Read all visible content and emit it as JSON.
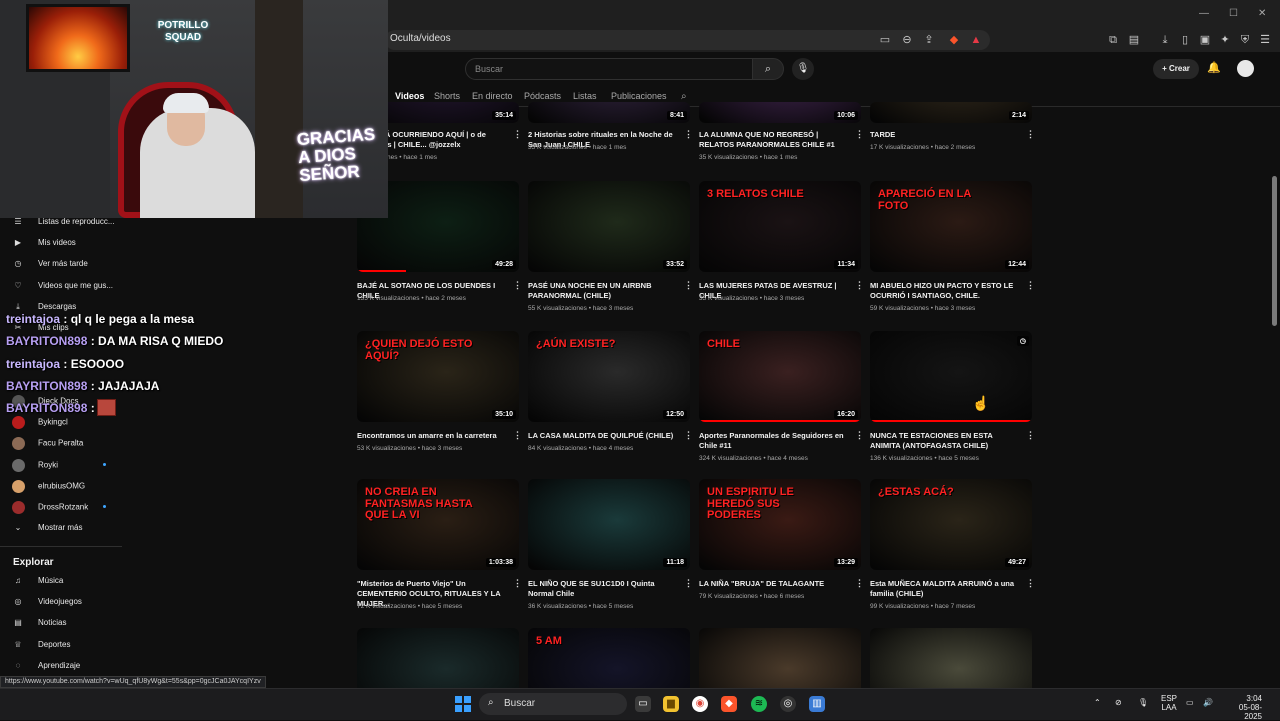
{
  "browser": {
    "url": "Oculta/videos",
    "window_controls": [
      "—",
      "☐",
      "✕"
    ]
  },
  "yt_header": {
    "search_placeholder": "Buscar",
    "create_label": "Crear"
  },
  "tabs": [
    "Videos",
    "Shorts",
    "En directo",
    "Pódcasts",
    "Listas",
    "Publicaciones"
  ],
  "active_tab": "Videos",
  "sidebar": {
    "items": [
      {
        "label": "Listas de reproducc...",
        "icon": "playlist-icon",
        "glyph": "☰"
      },
      {
        "label": "Mis videos",
        "icon": "my-videos-icon",
        "glyph": "▶"
      },
      {
        "label": "Ver más tarde",
        "icon": "watch-later-icon",
        "glyph": "◷"
      },
      {
        "label": "Videos que me gus...",
        "icon": "like-icon",
        "glyph": "👍"
      },
      {
        "label": "Descargas",
        "icon": "download-icon",
        "glyph": "⤓"
      },
      {
        "label": "Mis clips",
        "icon": "clip-icon",
        "glyph": "✂"
      }
    ],
    "subscriptions": [
      {
        "label": "Dieck Docs",
        "color": "#555555",
        "dot": false
      },
      {
        "label": "Bykingcl",
        "color": "#b91c1c",
        "dot": false
      },
      {
        "label": "Facu Peralta",
        "color": "#8b6a55",
        "dot": false
      },
      {
        "label": "Royki",
        "color": "#6a6a6a",
        "dot": true
      },
      {
        "label": "elrubiusOMG",
        "color": "#d7a06a",
        "dot": false
      },
      {
        "label": "DrossRotzank",
        "color": "#9b2c2c",
        "dot": true
      }
    ],
    "show_more": "Mostrar más",
    "explore_title": "Explorar",
    "explore": [
      {
        "label": "Música",
        "icon": "music-icon",
        "glyph": "♫"
      },
      {
        "label": "Videojuegos",
        "icon": "gaming-icon",
        "glyph": "🎮"
      },
      {
        "label": "Noticias",
        "icon": "news-icon",
        "glyph": "📰"
      },
      {
        "label": "Deportes",
        "icon": "trophy-icon",
        "glyph": "🏆"
      },
      {
        "label": "Aprendizaje",
        "icon": "lightbulb-icon",
        "glyph": "💡"
      }
    ]
  },
  "webcam": {
    "logo_text": "POTRILLO SQUAD",
    "neon_text": "GRACIAS A DIOS SEÑOR"
  },
  "chat": [
    {
      "user": "treintajoa",
      "message": "ql q le pega a la mesa"
    },
    {
      "user": "BAYRITON898",
      "message": "DA MA RISA Q MIEDO"
    },
    {
      "user": "treintajoa",
      "message": "ESOOOO"
    },
    {
      "user": "BAYRITON898",
      "message": "JAJAJAJA"
    },
    {
      "user": "BAYRITON898",
      "message": ""
    }
  ],
  "videos": [
    {
      "title": "RO ESTÁ OCURRIENDO AQUÍ | o de mascotas | CHILE... @jozzelx",
      "meta": "isualizaciones • hace 1 mes",
      "duration": "35:14",
      "bg": "#2a1a3a"
    },
    {
      "title": "2 Historias sobre rituales en la Noche de San Juan I CHILE",
      "meta": "35 K visualizaciones • hace 1 mes",
      "duration": "8:41",
      "bg": "#3a2a4a"
    },
    {
      "title": "LA ALUMNA QUE NO REGRESÓ | RELATOS PARANORMALES CHILE #1",
      "meta": "35 K visualizaciones • hace 1 mes",
      "duration": "10:06",
      "bg": "#4a2a5a"
    },
    {
      "title": "TARDE",
      "meta": "17 K visualizaciones • hace 2 meses",
      "duration": "2:14",
      "bg": "#3a3020"
    },
    {
      "title": "BAJÉ AL SOTANO DE LOS DUENDES I CHILE",
      "meta": "135 K visualizaciones • hace 2 meses",
      "duration": "49:28",
      "bg": "#0d1f14",
      "overlay": ""
    },
    {
      "title": "PASÉ UNA NOCHE EN UN AIRBNB PARANORMAL (CHILE)",
      "meta": "55 K visualizaciones • hace 3 meses",
      "duration": "33:52",
      "bg": "#1f2a1a"
    },
    {
      "title": "LAS MUJERES PATAS DE AVESTRUZ | CHILE",
      "meta": "35 K visualizaciones • hace 3 meses",
      "duration": "11:34",
      "bg": "#1a1214",
      "overlay": "3 RELATOS CHILE"
    },
    {
      "title": "MI ABUELO HIZO UN PACTO Y ESTO LE OCURRIÓ I SANTIAGO, CHILE.",
      "meta": "59 K visualizaciones • hace 3 meses",
      "duration": "12:44",
      "bg": "#2b1a14",
      "overlay": "APARECIÓ EN LA FOTO"
    },
    {
      "title": "Encontramos un amarre en la carretera",
      "meta": "53 K visualizaciones • hace 3 meses",
      "duration": "35:10",
      "bg": "#2a2418",
      "overlay": "¿QUIEN DEJÓ ESTO AQUÍ?"
    },
    {
      "title": "LA CASA MALDITA DE QUILPUÉ (CHILE)",
      "meta": "84 K visualizaciones • hace 4 meses",
      "duration": "12:50",
      "bg": "#2a2a2a",
      "overlay": "¿AÚN EXISTE?"
    },
    {
      "title": "Aportes Paranormales de Seguidores en Chile #11",
      "meta": "324 K visualizaciones • hace 4 meses",
      "duration": "16:20",
      "bg": "#3a2020",
      "overlay": "CHILE"
    },
    {
      "title": "NUNCA TE ESTACIONES EN ESTA ANIMITA (ANTOFAGASTA CHILE)",
      "meta": "136 K visualizaciones • hace 5 meses",
      "duration": "",
      "bg": "#141414"
    },
    {
      "title": "\"Misterios de Puerto Viejo\" Un CEMENTERIO OCULTO, RITUALES Y LA MUJER...",
      "meta": "72 K visualizaciones • hace 5 meses",
      "duration": "1:03:38",
      "bg": "#2a1e14",
      "overlay": "NO CREIA EN FANTASMAS HASTA QUE LA VI"
    },
    {
      "title": "EL NIÑO QUE SE SU1C1D0 I Quinta Normal Chile",
      "meta": "36 K visualizaciones • hace 5 meses",
      "duration": "11:18",
      "bg": "#1a3a3a"
    },
    {
      "title": "LA NIÑA \"BRUJA\" DE TALAGANTE",
      "meta": "79 K visualizaciones • hace 6 meses",
      "duration": "13:29",
      "bg": "#3a1a14",
      "overlay": "UN ESPIRITU LE HEREDÓ SUS PODERES"
    },
    {
      "title": "Esta MUÑECA MALDITA ARRUINÓ a una familia (CHILE)",
      "meta": "99 K visualizaciones • hace 7 meses",
      "duration": "49:27",
      "bg": "#2a2418",
      "overlay": "¿ESTAS ACÁ?"
    },
    {
      "title": "",
      "meta": "",
      "duration": "",
      "bg": "#1a2a2a"
    },
    {
      "title": "",
      "meta": "",
      "duration": "",
      "bg": "#141428",
      "overlay": "5 AM"
    },
    {
      "title": "",
      "meta": "",
      "duration": "",
      "bg": "#4a3a2a"
    },
    {
      "title": "",
      "meta": "",
      "duration": "",
      "bg": "#4a4a3a"
    }
  ],
  "status_url": "https://www.youtube.com/watch?v=wUq_qfU8yWg&t=55s&pp=0gcJCa0JAYcqIYzv",
  "taskbar": {
    "search_label": "Buscar",
    "lang_top": "ESP",
    "lang_bottom": "LAA",
    "time": "3:04",
    "date": "05-08-2025"
  }
}
